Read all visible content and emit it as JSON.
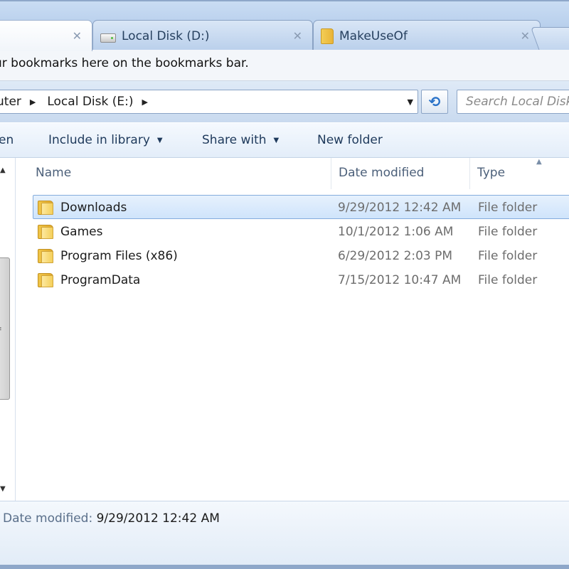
{
  "tabs": [
    {
      "label": "",
      "close": "✕",
      "icon": "blank-page-icon"
    },
    {
      "label": "Local Disk (D:)",
      "close": "✕",
      "icon": "drive-icon"
    },
    {
      "label": "MakeUseOf",
      "close": "✕",
      "icon": "folder-icon"
    }
  ],
  "bookmarks_bar": {
    "text": "ur bookmarks here on the bookmarks bar."
  },
  "address": {
    "crumbs": [
      "uter",
      "Local Disk (E:)"
    ],
    "separator": "▶",
    "dropdown": "▼",
    "refresh": "⟲"
  },
  "search": {
    "placeholder": "Search Local Disk"
  },
  "command_bar": {
    "open": "en",
    "include_in_library": "Include in library",
    "share_with": "Share with",
    "new_folder": "New folder",
    "caret": "▼"
  },
  "columns": {
    "name": "Name",
    "date_modified": "Date modified",
    "type": "Type",
    "sort_indicator": "▲"
  },
  "files": [
    {
      "name": "Downloads",
      "date": "9/29/2012 12:42 AM",
      "type": "File folder",
      "selected": true
    },
    {
      "name": "Games",
      "date": "10/1/2012 1:06 AM",
      "type": "File folder",
      "selected": false
    },
    {
      "name": "Program Files (x86)",
      "date": "6/29/2012 2:03 PM",
      "type": "File folder",
      "selected": false
    },
    {
      "name": "ProgramData",
      "date": "7/15/2012 10:47 AM",
      "type": "File folder",
      "selected": false
    }
  ],
  "nav_pane": {
    "scroll_up": "▲",
    "scroll_down": "▼",
    "grip": "≡"
  },
  "details": {
    "label": "Date modified:",
    "value": "9/29/2012 12:42 AM"
  },
  "colors": {
    "selection_fill": "#cfe4fb",
    "selection_border": "#84acdd",
    "chrome_blue": "#bcd1ea",
    "folder_yellow": "#f0c648"
  }
}
